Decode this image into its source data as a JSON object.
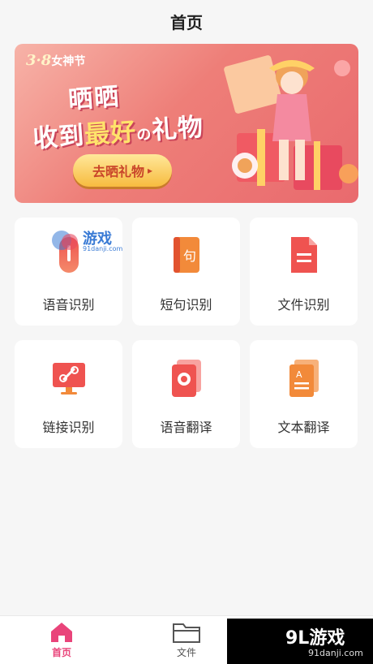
{
  "header": {
    "title": "首页"
  },
  "banner": {
    "badge_prefix": "3·8",
    "badge_text": "女神节",
    "headline_1": "晒晒",
    "headline_2a": "收到",
    "headline_2b": "最好",
    "headline_2c": "の",
    "headline_2d": "礼物",
    "cta_label": "去晒礼物",
    "cta_arrow": "▸"
  },
  "carousel": {
    "pages": 3,
    "active_page": 2
  },
  "features": [
    {
      "label": "语音识别",
      "icon": "microphone-icon"
    },
    {
      "label": "短句识别",
      "icon": "sentence-book-icon"
    },
    {
      "label": "文件识别",
      "icon": "document-icon"
    },
    {
      "label": "链接识别",
      "icon": "link-monitor-icon"
    },
    {
      "label": "语音翻译",
      "icon": "voice-translate-icon"
    },
    {
      "label": "文本翻译",
      "icon": "text-translate-icon"
    }
  ],
  "tabbar": {
    "home_label": "首页",
    "files_label": "文件"
  },
  "watermark": {
    "top_text": "游戏",
    "top_sub": "91danji.com",
    "bottom_text": "游戏",
    "bottom_sub": "91danji.com",
    "logo_glyph": "9L"
  },
  "colors": {
    "accent": "#e9447a",
    "icon_red": "#ef5350",
    "icon_orange": "#f57c3a"
  }
}
